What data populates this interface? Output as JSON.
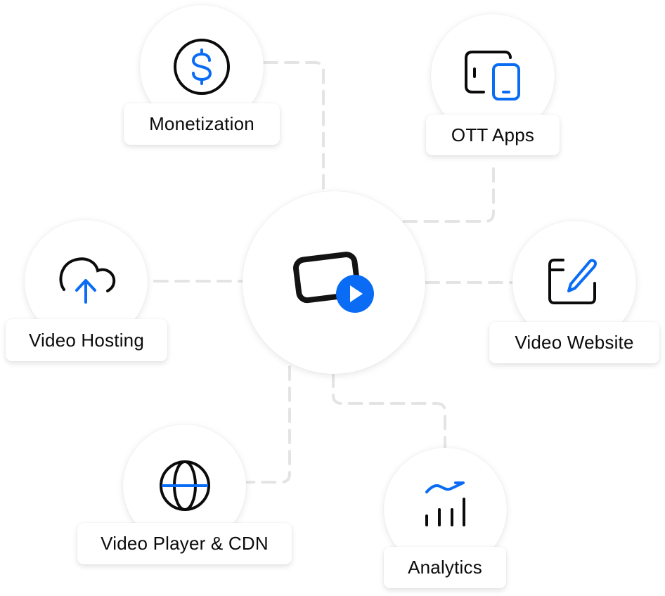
{
  "diagram": {
    "title": "",
    "accent_color": "#0a6cf5",
    "stroke_color": "#0b0b0b",
    "connector_color": "#e4e4e6",
    "center": {
      "icon": "video-play-icon"
    },
    "nodes": [
      {
        "id": "monetization",
        "label": "Monetization",
        "icon": "dollar-coin-icon"
      },
      {
        "id": "ott-apps",
        "label": "OTT Apps",
        "icon": "devices-icon"
      },
      {
        "id": "video-hosting",
        "label": "Video Hosting",
        "icon": "cloud-upload-icon"
      },
      {
        "id": "video-website",
        "label": "Video Website",
        "icon": "edit-window-icon"
      },
      {
        "id": "video-player-cdn",
        "label": "Video Player & CDN",
        "icon": "globe-icon"
      },
      {
        "id": "analytics",
        "label": "Analytics",
        "icon": "analytics-chart-icon"
      }
    ]
  }
}
